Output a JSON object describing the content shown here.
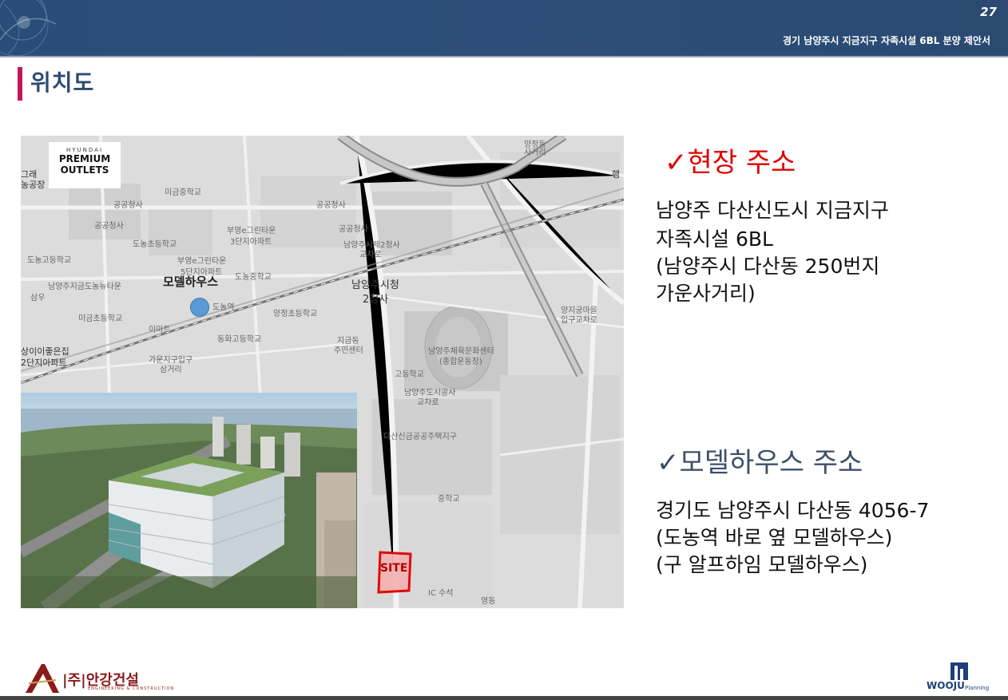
{
  "header": {
    "page_number": "27",
    "document_title": "경기 남양주시 지금지구 자족시설 6BL 분양 제안서"
  },
  "section": {
    "title": "위치도"
  },
  "map": {
    "outlets": {
      "small": "HYUNDAI",
      "line1": "PREMIUM",
      "line2": "OUTLETS"
    },
    "labels": {
      "l1": "미금중학교",
      "l2": "부영e그린타운",
      "l3": "3단지아파트",
      "l4": "도농초등학교",
      "l5": "부영e그린타운",
      "l6": "5단지아파트",
      "l7": "도농중학교",
      "l8": "모델하우스",
      "l9": "도농고등학교",
      "l10": "남양주지금도농뉴타운",
      "l11": "도농역",
      "l12": "미금초등학교",
      "l13": "이마트",
      "l14": "양정초등학교",
      "l15": "동화고등학교",
      "l16": "남양주시청",
      "l17": "2청사",
      "l18": "지금동",
      "l19": "주민센터",
      "l20": "남양주체육문화센터",
      "l21": "(종합운동장)",
      "l22": "남양주시제2청사",
      "l23": "교차로",
      "l24": "가운지구입구",
      "l25": "삼거리",
      "l26": "고등학교",
      "l27": "남양주도시공사",
      "l28": "교차로",
      "l29": "다산신금공공주택지구",
      "l30": "중학교",
      "l31": "양지궁마을",
      "l32": "입구교차로",
      "l33": "양정동",
      "l34": "사거리",
      "l35": "공공청사",
      "l36": "공공청사",
      "l37": "공공청사",
      "l38": "공공청사",
      "l39": "삼우",
      "l40": "상이이좋은집",
      "l41": "2단지아파트",
      "l42": "그래",
      "l43": "농공장",
      "l44": "영동",
      "l45": "IC 수석",
      "l46": "행"
    },
    "site_label": "SITE"
  },
  "site_address": {
    "heading": "✓현장 주소",
    "line1": "남양주 다산신도시 지금지구",
    "line2": "자족시설 6BL",
    "line3": "(남양주시 다산동 250번지",
    "line4": "가운사거리)"
  },
  "model_address": {
    "heading": "✓모델하우스 주소",
    "line1": "경기도 남양주시 다산동 4056-7",
    "line2": "(도농역 바로 옆 모델하우스)",
    "line3": "(구 알프하임 모델하우스)"
  },
  "footer": {
    "left_logo": "|주|안강건설",
    "left_logo_sub": "ENGINEERING & CONSTRUCTION",
    "right_logo": "WOOJU",
    "right_logo_sub": "Planning"
  },
  "colors": {
    "header": "#2c4f79",
    "accent_bar": "#c2185b",
    "section_title": "#2e4b72",
    "site_heading": "#e00000",
    "model_heading": "#3c4f6a"
  }
}
